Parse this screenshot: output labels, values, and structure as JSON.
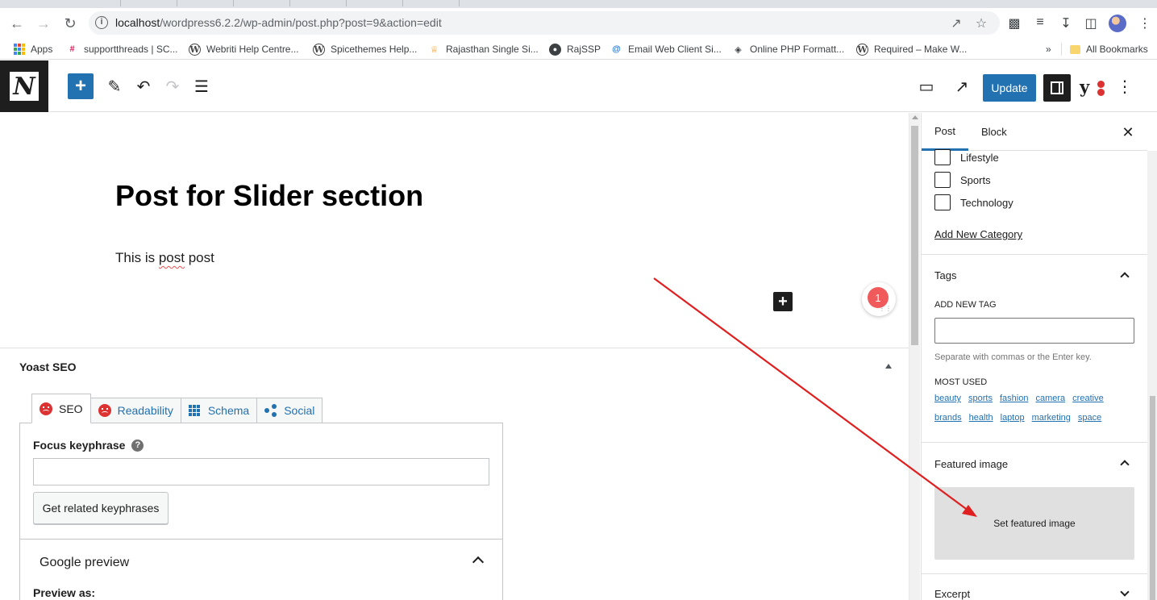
{
  "browser": {
    "url_host": "localhost",
    "url_path": "/wordpress6.2.2/wp-admin/post.php?post=9&action=edit",
    "bookmarks": [
      {
        "label": "Apps",
        "icon": "apps-grid-icon"
      },
      {
        "label": "supportthreads | SC...",
        "icon": "slack-icon"
      },
      {
        "label": "Webriti Help Centre...",
        "icon": "wordpress-icon"
      },
      {
        "label": "Spicethemes Help...",
        "icon": "wordpress-icon"
      },
      {
        "label": "Rajasthan Single Si...",
        "icon": "crown-icon"
      },
      {
        "label": "RajSSP",
        "icon": "globe-icon"
      },
      {
        "label": "Email Web Client Si...",
        "icon": "at-icon"
      },
      {
        "label": "Online PHP Formatt...",
        "icon": "diamond-icon"
      },
      {
        "label": "Required – Make W...",
        "icon": "wordpress-icon"
      }
    ],
    "overflow": "»",
    "all_bookmarks": "All Bookmarks"
  },
  "toolbar": {
    "update_label": "Update"
  },
  "post": {
    "title": "Post for Slider section",
    "para_pre": "This is ",
    "para_spell": "post",
    "para_post": " post"
  },
  "grammarly": {
    "count": "1"
  },
  "yoast": {
    "title": "Yoast SEO",
    "tabs": [
      {
        "label": "SEO",
        "icon": "sad-face-icon"
      },
      {
        "label": "Readability",
        "icon": "sad-face-icon"
      },
      {
        "label": "Schema",
        "icon": "grid-icon"
      },
      {
        "label": "Social",
        "icon": "share-icon"
      }
    ],
    "focus_keyphrase_label": "Focus keyphrase",
    "related_button": "Get related keyphrases",
    "google_preview_title": "Google preview",
    "preview_as": "Preview as:"
  },
  "sidebar": {
    "tabs": [
      "Post",
      "Block"
    ],
    "categories": [
      "Lifestyle",
      "Sports",
      "Technology"
    ],
    "add_new_category": "Add New Category",
    "tags_title": "Tags",
    "add_new_tag_label": "ADD NEW TAG",
    "tag_help": "Separate with commas or the Enter key.",
    "most_used_label": "MOST USED",
    "most_used_row1": [
      "beauty",
      "sports",
      "fashion",
      "camera",
      "creative"
    ],
    "most_used_row2": [
      "brands",
      "health",
      "laptop",
      "marketing",
      "space"
    ],
    "featured_title": "Featured image",
    "set_featured": "Set featured image",
    "excerpt_title": "Excerpt"
  },
  "colors": {
    "accent": "#2271b1",
    "error": "#dc3232",
    "annotation_arrow": "#e02020"
  }
}
